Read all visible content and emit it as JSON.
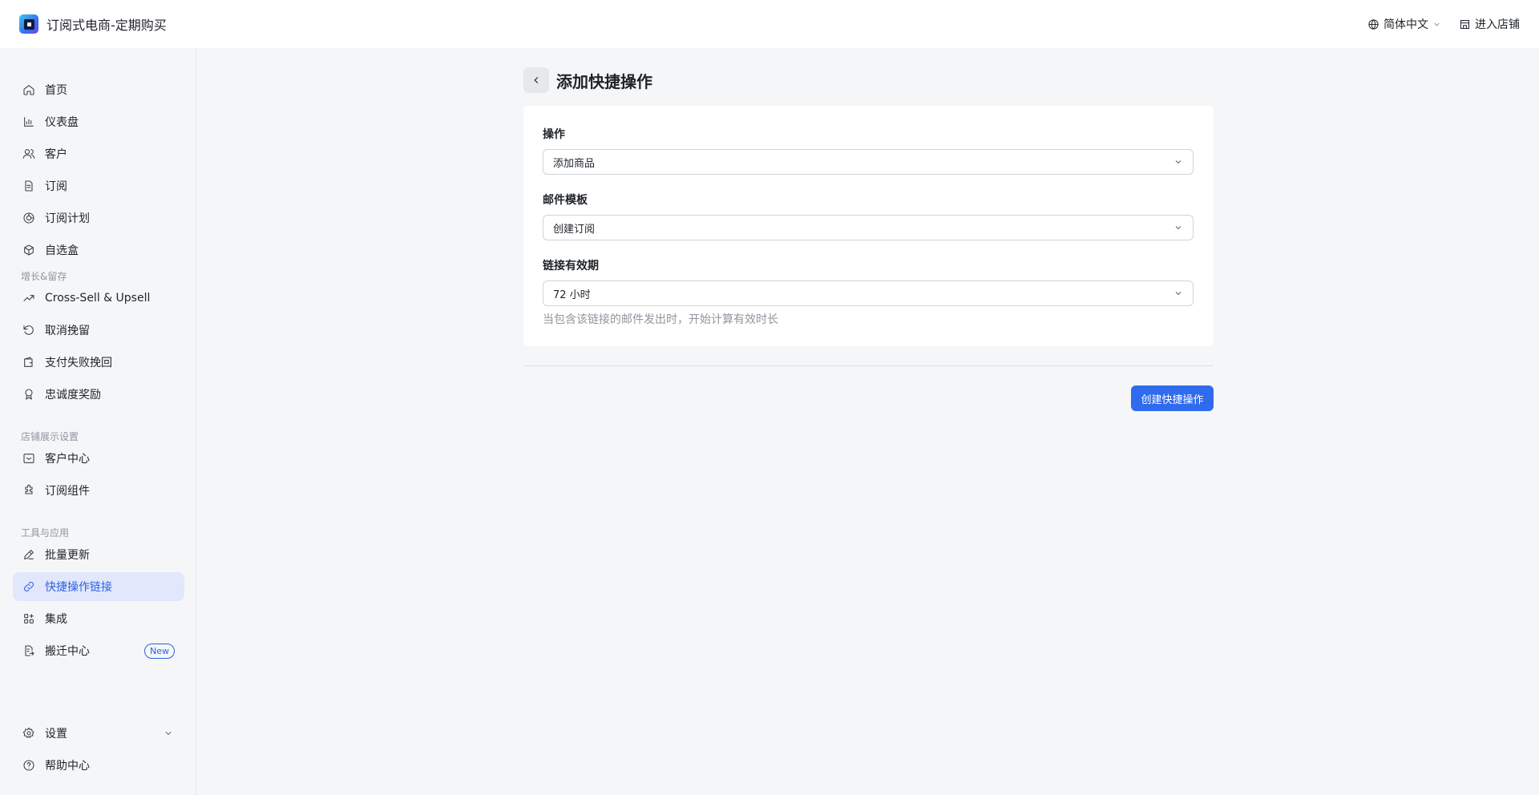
{
  "app": {
    "title": "订阅式电商-定期购买"
  },
  "topbar": {
    "language": "简体中文",
    "store": "进入店铺"
  },
  "sidebar": {
    "main": [
      {
        "label": "首页",
        "icon": "home-icon"
      },
      {
        "label": "仪表盘",
        "icon": "bar-chart-icon"
      },
      {
        "label": "客户",
        "icon": "users-icon"
      },
      {
        "label": "订阅",
        "icon": "document-icon"
      },
      {
        "label": "订阅计划",
        "icon": "plan-icon"
      },
      {
        "label": "自选盒",
        "icon": "box-icon"
      }
    ],
    "growth_title": "增长&留存",
    "growth": [
      {
        "label": "Cross-Sell & Upsell",
        "icon": "trending-up-icon"
      },
      {
        "label": "取消挽留",
        "icon": "rotate-ccw-icon"
      },
      {
        "label": "支付失败挽回",
        "icon": "wallet-icon"
      },
      {
        "label": "忠诚度奖励",
        "icon": "award-icon"
      }
    ],
    "store_title": "店铺展示设置",
    "store": [
      {
        "label": "客户中心",
        "icon": "inbox-icon"
      },
      {
        "label": "订阅组件",
        "icon": "puzzle-icon"
      }
    ],
    "tools_title": "工具与应用",
    "tools": [
      {
        "label": "批量更新",
        "icon": "pencil-icon"
      },
      {
        "label": "快捷操作链接",
        "icon": "link-icon",
        "active": true
      },
      {
        "label": "集成",
        "icon": "grid-icon"
      },
      {
        "label": "搬迁中心",
        "icon": "file-export-icon",
        "badge": "New"
      }
    ],
    "footer": [
      {
        "label": "设置",
        "icon": "gear-icon"
      },
      {
        "label": "帮助中心",
        "icon": "help-circle-icon"
      }
    ]
  },
  "page": {
    "title": "添加快捷操作",
    "fields": {
      "action": {
        "label": "操作",
        "value": "添加商品"
      },
      "email_template": {
        "label": "邮件模板",
        "value": "创建订阅"
      },
      "expiry": {
        "label": "链接有效期",
        "value": "72 小时",
        "help": "当包含该链接的邮件发出时，开始计算有效时长"
      }
    },
    "submit_label": "创建快捷操作"
  },
  "colors": {
    "primary": "#2f6bed",
    "active_bg": "#e1e8fc",
    "background": "#f5f6f8"
  }
}
